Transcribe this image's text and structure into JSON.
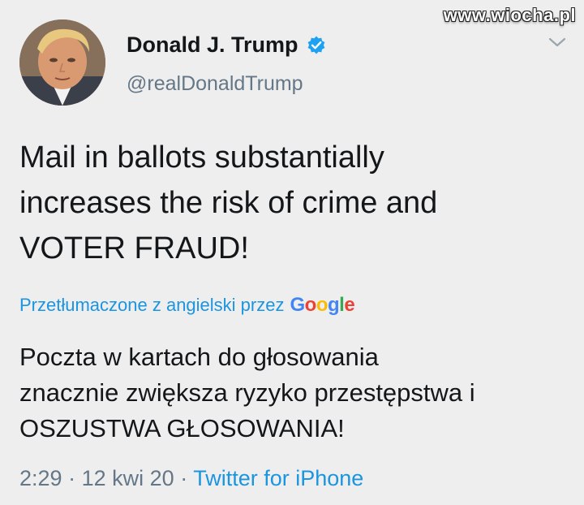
{
  "watermark": "www.wiocha.pl",
  "user": {
    "display_name": "Donald J. Trump",
    "handle": "@realDonaldTrump",
    "avatar_icon": "profile-photo",
    "verified_icon": "verified-badge-icon"
  },
  "tweet": {
    "lines": [
      "Mail in ballots substantially",
      "increases the risk of crime and",
      "VOTER FRAUD!"
    ]
  },
  "translation": {
    "label": "Przetłumaczone z angielski przez",
    "provider": "Google",
    "lines": [
      "Poczta w kartach do głosowania",
      "znacznie zwiększa ryzyko przestępstwa i",
      "OSZUSTWA GŁOSOWANIA!"
    ]
  },
  "meta": {
    "time": "2:29",
    "separator": "·",
    "date": "12 kwi 20",
    "source": "Twitter for iPhone"
  },
  "colors": {
    "link": "#1b95e0",
    "muted": "#657786",
    "text": "#14171a",
    "background": "#eeeeee"
  }
}
